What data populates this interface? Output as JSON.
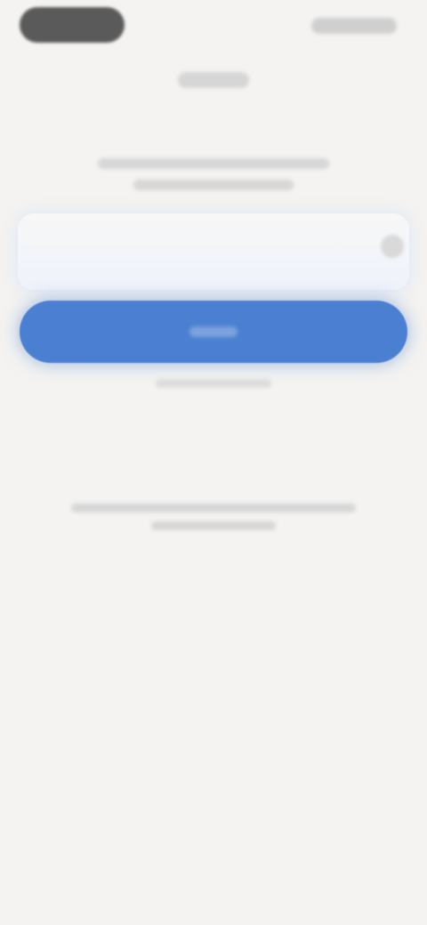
{
  "app": {
    "title": ""
  },
  "intro": {
    "line1": "",
    "line2": ""
  },
  "field": {
    "value": "",
    "placeholder": ""
  },
  "primary_button": {
    "label": ""
  },
  "secondary_link": {
    "label": ""
  },
  "legal": {
    "line1": "",
    "line2": ""
  },
  "colors": {
    "background": "#f4f3f1",
    "accent": "#4a7fd1"
  }
}
